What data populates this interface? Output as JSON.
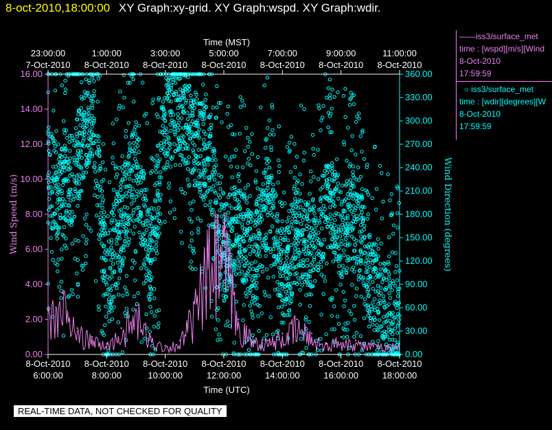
{
  "header": {
    "time_label": "8-oct-2010,18:00:00",
    "graphs_label": "XY Graph:xy-grid.  XY Graph:wspd.  XY Graph:wdir."
  },
  "colors": {
    "wspd": "#ee82ee",
    "wdir": "#00ffff",
    "axis": "#ffffff"
  },
  "legend": {
    "wspd": {
      "line1": "iss3/surface_met",
      "line2": "time : [wspd][m/s][Wind",
      "line3": "8-Oct-2010",
      "line4": "17:59:59"
    },
    "wdir": {
      "line1": "iss3/surface_met",
      "line2": "time : [wdir][degrees][W",
      "line3": "8-Oct-2010",
      "line4": "17:59:59"
    }
  },
  "disclaimer": "REAL-TIME DATA, NOT CHECKED FOR QUALITY",
  "chart_data": {
    "type": "scatter",
    "top_axis": {
      "label": "Time (MST)",
      "ticks": [
        {
          "time": "23:00:00",
          "date": "7-Oct-2010"
        },
        {
          "time": "1:00:00",
          "date": "8-Oct-2010"
        },
        {
          "time": "3:00:00",
          "date": "8-Oct-2010"
        },
        {
          "time": "5:00:00",
          "date": "8-Oct-2010"
        },
        {
          "time": "7:00:00",
          "date": "8-Oct-2010"
        },
        {
          "time": "9:00:00",
          "date": "8-Oct-2010"
        },
        {
          "time": "11:00:00",
          "date": "8-Oct-2010"
        }
      ]
    },
    "bottom_axis": {
      "label": "Time (UTC)",
      "ticks": [
        {
          "date": "8-Oct-2010",
          "time": "6:00:00"
        },
        {
          "date": "8-Oct-2010",
          "time": "8:00:00"
        },
        {
          "date": "8-Oct-2010",
          "time": "10:00:00"
        },
        {
          "date": "8-Oct-2010",
          "time": "12:00:00"
        },
        {
          "date": "8-Oct-2010",
          "time": "14:00:00"
        },
        {
          "date": "8-Oct-2010",
          "time": "16:00:00"
        },
        {
          "date": "8-Oct-2010",
          "time": "18:00:00"
        }
      ],
      "xlim": [
        "2010-10-08 06:00",
        "2010-10-08 18:00"
      ]
    },
    "left_axis": {
      "label": "Wind Speed (m/s)",
      "ylim": [
        0,
        16
      ],
      "ticks": [
        "0.00",
        "2.00",
        "4.00",
        "6.00",
        "8.00",
        "10.00",
        "12.00",
        "14.00",
        "16.00"
      ]
    },
    "right_axis": {
      "label": "Wind Direction (degrees)",
      "ylim": [
        0,
        360
      ],
      "ticks": [
        "0.00",
        "30.00",
        "60.00",
        "90.00",
        "120.00",
        "150.00",
        "180.00",
        "210.00",
        "240.00",
        "270.00",
        "300.00",
        "330.00",
        "360.00"
      ]
    },
    "series": [
      {
        "name": "iss3/surface_met",
        "variable": "wspd",
        "style": "line",
        "axis": "left",
        "x": [
          "06:00",
          "06:30",
          "07:00",
          "07:30",
          "08:00",
          "08:30",
          "09:00",
          "09:30",
          "10:00",
          "10:30",
          "11:00",
          "11:30",
          "12:00",
          "12:30",
          "13:00",
          "13:30",
          "14:00",
          "14:30",
          "15:00",
          "15:30",
          "16:00",
          "16:30",
          "17:00",
          "17:30",
          "18:00"
        ],
        "y": [
          2.5,
          3.5,
          1.5,
          1.0,
          0.6,
          1.5,
          2.8,
          1.0,
          0.5,
          0.8,
          3.0,
          6.5,
          7.5,
          2.0,
          1.0,
          0.8,
          1.2,
          2.0,
          1.2,
          0.6,
          1.0,
          0.8,
          0.6,
          0.5,
          0.6
        ]
      },
      {
        "name": "iss3/surface_met",
        "variable": "wdir",
        "style": "points",
        "axis": "right",
        "x": [
          "06:00",
          "06:30",
          "07:00",
          "07:30",
          "08:00",
          "08:30",
          "09:00",
          "09:30",
          "10:00",
          "10:30",
          "11:00",
          "11:30",
          "12:00",
          "12:30",
          "13:00",
          "13:30",
          "14:00",
          "14:30",
          "15:00",
          "15:30",
          "16:00",
          "16:30",
          "17:00",
          "17:30",
          "18:00"
        ],
        "y": [
          230,
          200,
          250,
          320,
          90,
          170,
          240,
          120,
          300,
          320,
          280,
          250,
          130,
          170,
          110,
          200,
          90,
          150,
          130,
          200,
          160,
          170,
          100,
          60,
          50
        ]
      }
    ]
  }
}
